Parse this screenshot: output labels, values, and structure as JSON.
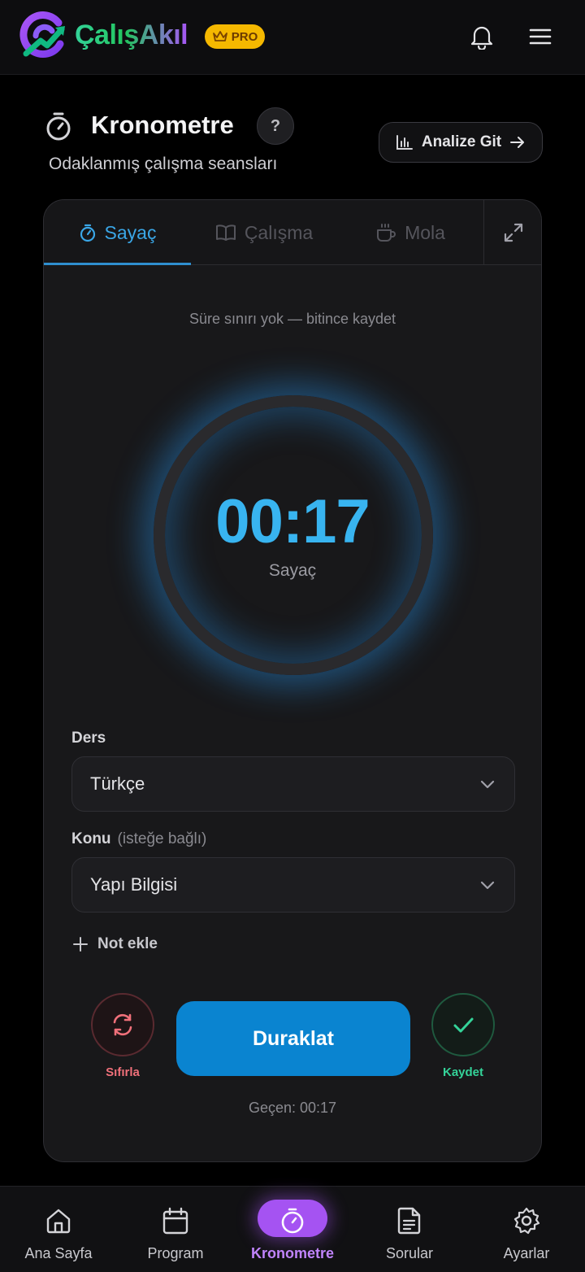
{
  "header": {
    "brand": "ÇalışAkıl",
    "pro_badge": "PRO",
    "icons": [
      "bell-icon",
      "menu-icon"
    ]
  },
  "page": {
    "title": "Kronometre",
    "help": "?",
    "subtitle": "Odaklanmış çalışma seansları",
    "analyze_button": "Analize Git"
  },
  "tabs": [
    {
      "label": "Sayaç",
      "active": true,
      "icon": "stopwatch-icon"
    },
    {
      "label": "Çalışma",
      "active": false,
      "icon": "book-icon"
    },
    {
      "label": "Mola",
      "active": false,
      "icon": "cup-icon"
    }
  ],
  "timer": {
    "hint": "Süre sınırı yok — bitince kaydet",
    "time": "00:17",
    "mode_label": "Sayaç"
  },
  "form": {
    "course_label": "Ders",
    "course_value": "Türkçe",
    "topic_label": "Konu",
    "topic_optional": "(isteğe bağlı)",
    "topic_value": "Yapı Bilgisi",
    "add_note": "Not ekle"
  },
  "controls": {
    "reset_label": "Sıfırla",
    "pause_label": "Duraklat",
    "save_label": "Kaydet",
    "elapsed": "Geçen: 00:17"
  },
  "bottom_nav": [
    {
      "label": "Ana Sayfa",
      "icon": "home-icon",
      "active": false
    },
    {
      "label": "Program",
      "icon": "calendar-icon",
      "active": false
    },
    {
      "label": "Kronometre",
      "icon": "stopwatch-icon",
      "active": true
    },
    {
      "label": "Sorular",
      "icon": "document-icon",
      "active": false
    },
    {
      "label": "Ayarlar",
      "icon": "gear-icon",
      "active": false
    }
  ],
  "colors": {
    "accent_blue": "#0a84d0",
    "timer_blue": "#38b4f0",
    "active_purple": "#a553f2",
    "reset_red": "#f0707a",
    "save_green": "#34d399",
    "pro_gold": "#f5b800"
  }
}
